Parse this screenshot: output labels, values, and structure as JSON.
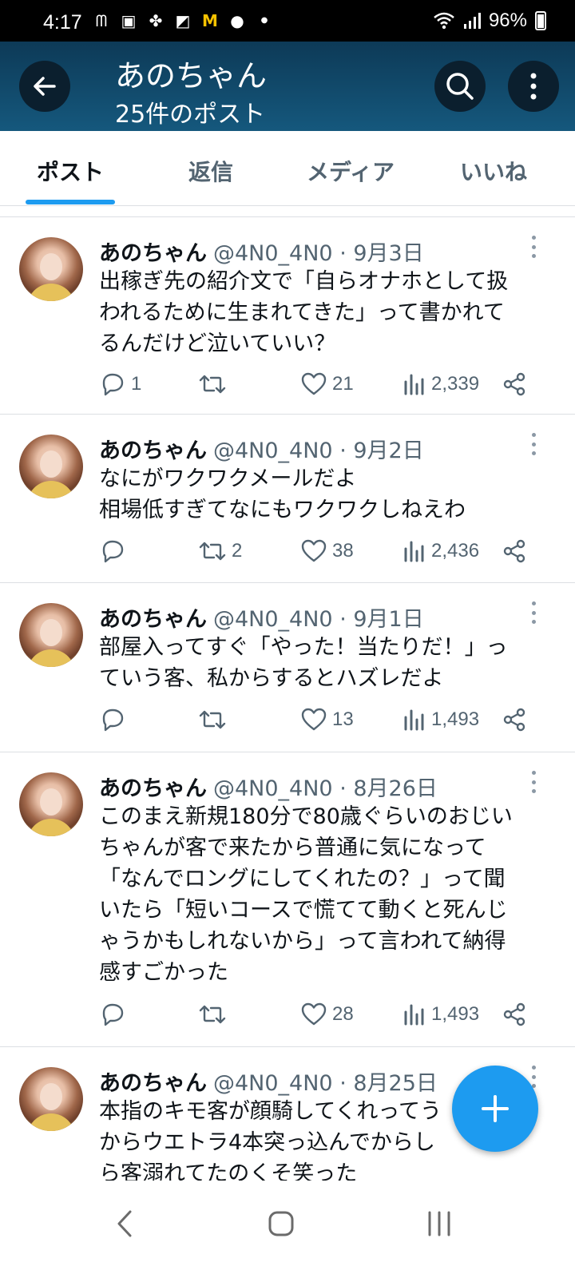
{
  "status_bar": {
    "time": "4:17",
    "notification_icons": [
      "m-icon",
      "box-icon",
      "clover-icon",
      "cube-icon",
      "mcdonalds-icon",
      "line-icon",
      "dot-icon"
    ],
    "battery": "96%"
  },
  "header": {
    "title": "あのちゃん",
    "subtitle": "25件のポスト"
  },
  "tabs": [
    {
      "label": "ポスト",
      "active": true
    },
    {
      "label": "返信",
      "active": false
    },
    {
      "label": "メディア",
      "active": false
    },
    {
      "label": "いいね",
      "active": false
    }
  ],
  "posts": [
    {
      "name": "あのちゃん",
      "handle": "@4N0_4N0",
      "date": "9月3日",
      "text": "出稼ぎ先の紹介文で「自らオナホとして扱\nわれるために生まれてきた」って書かれて\nるんだけど泣いていい？",
      "replies": "1",
      "reposts": "",
      "likes": "21",
      "views": "2,339"
    },
    {
      "name": "あのちゃん",
      "handle": "@4N0_4N0",
      "date": "9月2日",
      "text": "なにがワクワクメールだよ\n相場低すぎてなにもワクワクしねえわ",
      "replies": "",
      "reposts": "2",
      "likes": "38",
      "views": "2,436"
    },
    {
      "name": "あのちゃん",
      "handle": "@4N0_4N0",
      "date": "9月1日",
      "text": "部屋入ってすぐ「やった！当たりだ！」っ\nていう客、私からするとハズレだよ",
      "replies": "",
      "reposts": "",
      "likes": "13",
      "views": "1,493"
    },
    {
      "name": "あのちゃん",
      "handle": "@4N0_4N0",
      "date": "8月26日",
      "text": "このまえ新規180分で80歳ぐらいのおじい\nちゃんが客で来たから普通に気になって\n「なんでロングにしてくれたの？」って聞\nいたら「短いコースで慌てて動くと死んじ\nゃうかもしれないから」って言われて納得\n感すごかった",
      "replies": "",
      "reposts": "",
      "likes": "28",
      "views": "1,493"
    },
    {
      "name": "あのちゃん",
      "handle": "@4N0_4N0",
      "date": "8月25日",
      "text": "本指のキモ客が顔騎してくれってう\nからウエトラ4本突っ込んでからし\nら客溺れてたのくそ笑った",
      "replies": "",
      "reposts": "",
      "likes": "",
      "views": ""
    }
  ],
  "colors": {
    "accent": "#1d9bf0",
    "header_bg": "#15587d",
    "secondary_text": "#536471"
  }
}
